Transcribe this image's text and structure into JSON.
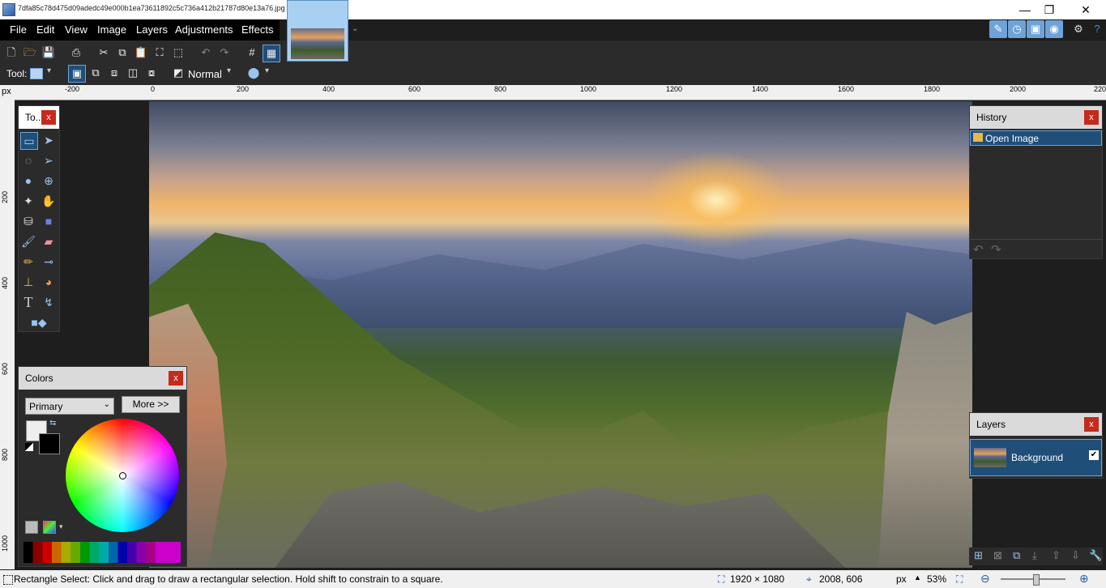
{
  "window": {
    "title": "7dfa85c78d475d09adedc49e000b1ea73611892c5c736a412b21787d80e13a76.jpg - paint.net 4.2.12",
    "minimize_symbol": "—",
    "restore_symbol": "❐",
    "close_symbol": "✕"
  },
  "menu": [
    "File",
    "Edit",
    "View",
    "Image",
    "Layers",
    "Adjustments",
    "Effects"
  ],
  "toolbar": {
    "tool_label": "Tool:",
    "blend_mode": "Normal"
  },
  "ruler": {
    "unit": "px",
    "h_ticks": [
      "-200",
      "0",
      "200",
      "400",
      "600",
      "800",
      "1000",
      "1200",
      "1400",
      "1600",
      "1800",
      "2000",
      "220"
    ],
    "v_ticks": [
      "200",
      "400",
      "600",
      "800",
      "1000"
    ]
  },
  "tools_panel": {
    "title": "To...",
    "close": "x"
  },
  "history_panel": {
    "title": "History",
    "close": "x",
    "items": [
      "Open Image"
    ],
    "undo_icon": "↶",
    "redo_icon": "↷"
  },
  "layers_panel": {
    "title": "Layers",
    "close": "x",
    "layers": [
      {
        "name": "Background",
        "visible": true,
        "check": "✔"
      }
    ]
  },
  "colors_panel": {
    "title": "Colors",
    "close": "x",
    "selector": "Primary",
    "more_button": "More >>"
  },
  "status": {
    "message": "Rectangle Select: Click and drag to draw a rectangular selection. Hold shift to constrain to a square.",
    "image_size": "1920 × 1080",
    "cursor_pos": "2008, 606",
    "unit": "px",
    "zoom": "53%",
    "zoom_level": 0.53
  },
  "colors": {
    "accent": "#2b5fa3",
    "selection": "#1f4e79",
    "close_red": "#c42b1c"
  }
}
